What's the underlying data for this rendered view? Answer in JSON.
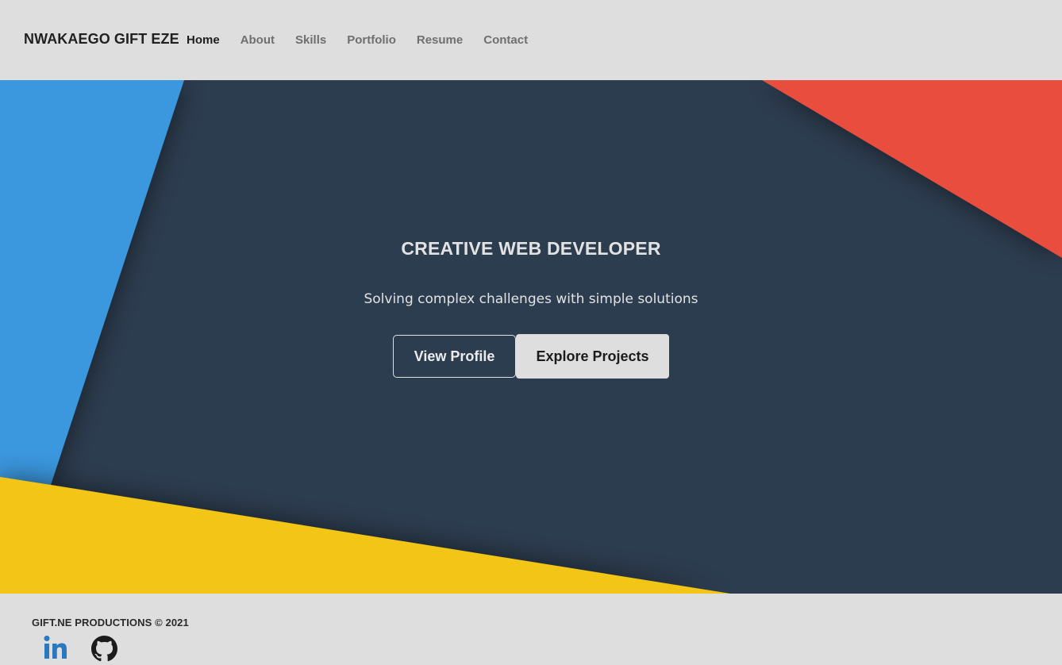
{
  "navbar": {
    "brand": "NWAKAEGO GIFT EZE",
    "links": [
      {
        "label": "Home",
        "active": true
      },
      {
        "label": "About",
        "active": false
      },
      {
        "label": "Skills",
        "active": false
      },
      {
        "label": "Portfolio",
        "active": false
      },
      {
        "label": "Resume",
        "active": false
      },
      {
        "label": "Contact",
        "active": false
      }
    ]
  },
  "hero": {
    "title": "CREATIVE WEB DEVELOPER",
    "subtitle": "Solving complex challenges with simple solutions",
    "primary_button": "View Profile",
    "secondary_button": "Explore Projects"
  },
  "footer": {
    "copyright": "GIFT.NE PRODUCTIONS © 2021",
    "social": [
      {
        "icon": "linkedin-icon"
      },
      {
        "icon": "github-icon"
      }
    ]
  },
  "colors": {
    "background": "#dedede",
    "hero_dark": "#2d3d50",
    "blue": "#3a97de",
    "red": "#e84e3d",
    "yellow": "#f2c512",
    "linkedin": "#2a78bd"
  }
}
